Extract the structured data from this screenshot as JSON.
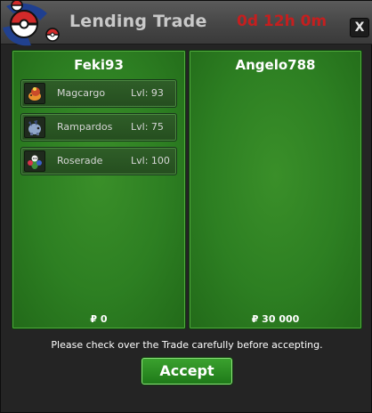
{
  "window": {
    "title": "Lending Trade",
    "timer": "0d 12h 0m",
    "close_label": "X",
    "emblem_icon": "pokeball-emblem-icon"
  },
  "left_panel": {
    "owner": "Feki93",
    "pokemon": [
      {
        "name": "Magcargo",
        "level": "Lvl: 93",
        "icon": "magcargo-sprite-icon"
      },
      {
        "name": "Rampardos",
        "level": "Lvl: 75",
        "icon": "rampardos-sprite-icon"
      },
      {
        "name": "Roserade",
        "level": "Lvl: 100",
        "icon": "roserade-sprite-icon"
      }
    ],
    "money": "₽ 0"
  },
  "right_panel": {
    "owner": "Angelo788",
    "pokemon": [],
    "money": "₽ 30 000"
  },
  "notice": "Please check over the Trade carefully before accepting.",
  "accept_label": "Accept",
  "colors": {
    "panel_green": "#2d7f22",
    "timer_red": "#c41f1f",
    "window_bg": "#242424"
  }
}
